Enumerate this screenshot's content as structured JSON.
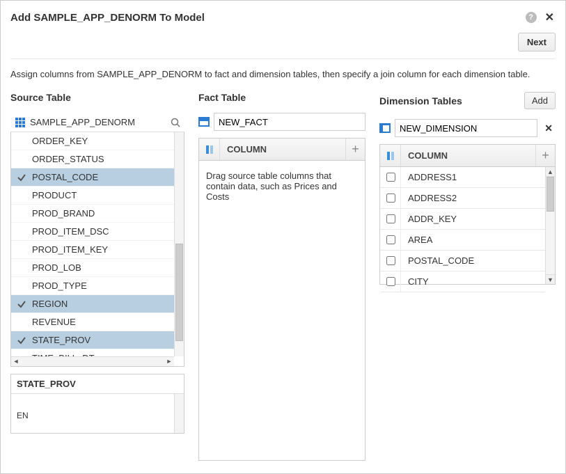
{
  "dialog": {
    "title": "Add SAMPLE_APP_DENORM To Model",
    "next_label": "Next",
    "instruction": "Assign columns from SAMPLE_APP_DENORM to fact and dimension tables, then specify a join column for each dimension table."
  },
  "source": {
    "section_label": "Source Table",
    "table_name": "SAMPLE_APP_DENORM",
    "columns": [
      {
        "name": "ORDER_KEY",
        "selected": false
      },
      {
        "name": "ORDER_STATUS",
        "selected": false
      },
      {
        "name": "POSTAL_CODE",
        "selected": true
      },
      {
        "name": "PRODUCT",
        "selected": false
      },
      {
        "name": "PROD_BRAND",
        "selected": false
      },
      {
        "name": "PROD_ITEM_DSC",
        "selected": false
      },
      {
        "name": "PROD_ITEM_KEY",
        "selected": false
      },
      {
        "name": "PROD_LOB",
        "selected": false
      },
      {
        "name": "PROD_TYPE",
        "selected": false
      },
      {
        "name": "REGION",
        "selected": true
      },
      {
        "name": "REVENUE",
        "selected": false
      },
      {
        "name": "STATE_PROV",
        "selected": true
      },
      {
        "name": "TIME_BILL_DT",
        "selected": false
      }
    ],
    "detail": {
      "title": "STATE_PROV",
      "value": "EN"
    }
  },
  "fact": {
    "section_label": "Fact Table",
    "name": "NEW_FACT",
    "column_header": "COLUMN",
    "placeholder_text": "Drag source table columns that contain data, such as Prices and Costs"
  },
  "dimension": {
    "section_label": "Dimension Tables",
    "add_label": "Add",
    "name": "NEW_DIMENSION",
    "column_header": "COLUMN",
    "columns": [
      {
        "name": "ADDRESS1",
        "checked": false
      },
      {
        "name": "ADDRESS2",
        "checked": false
      },
      {
        "name": "ADDR_KEY",
        "checked": false
      },
      {
        "name": "AREA",
        "checked": false
      },
      {
        "name": "POSTAL_CODE",
        "checked": false
      },
      {
        "name": "CITY",
        "checked": false
      }
    ]
  }
}
